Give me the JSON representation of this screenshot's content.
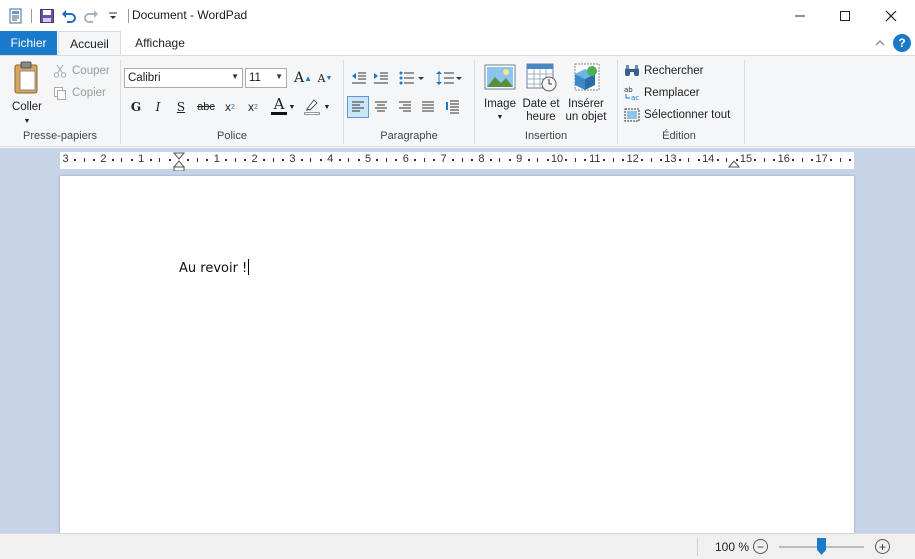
{
  "window": {
    "title": "Document - WordPad"
  },
  "tabs": {
    "file": "Fichier",
    "home": "Accueil",
    "view": "Affichage"
  },
  "clipboard": {
    "paste": "Coller",
    "cut": "Couper",
    "copy": "Copier",
    "label": "Presse-papiers"
  },
  "font": {
    "family": "Calibri",
    "size": "11",
    "bold": "G",
    "italic": "I",
    "strike": "abc",
    "label": "Police"
  },
  "paragraph": {
    "label": "Paragraphe"
  },
  "insert": {
    "image": "Image",
    "datetime_line1": "Date et",
    "datetime_line2": "heure",
    "object_line1": "Insérer",
    "object_line2": "un objet",
    "label": "Insertion"
  },
  "editing": {
    "find": "Rechercher",
    "replace": "Remplacer",
    "select_all": "Sélectionner tout",
    "label": "Édition"
  },
  "ruler": {
    "numbers": [
      "3",
      "2",
      "1",
      "1",
      "2",
      "3",
      "4",
      "5",
      "6",
      "7",
      "8",
      "9",
      "10",
      "11",
      "12",
      "13",
      "14",
      "15",
      "16",
      "17"
    ]
  },
  "document": {
    "text": "Au revoir !"
  },
  "status": {
    "zoom": "100 %"
  },
  "colors": {
    "accent": "#1979ca",
    "workspace": "#c7d3e6"
  }
}
